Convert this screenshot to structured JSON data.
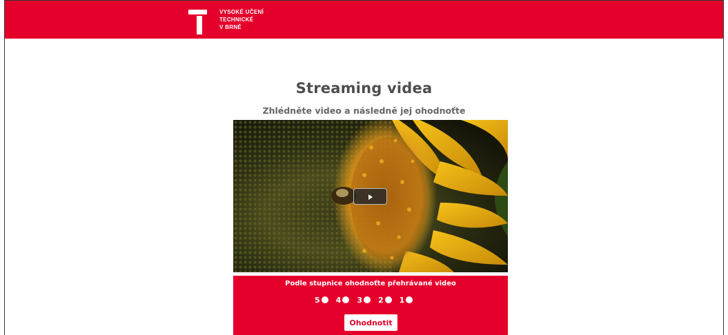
{
  "header": {
    "logo_lines": [
      "VYSOKÉ UČENÍ",
      "TECHNICKÉ",
      "V BRNĚ"
    ]
  },
  "main": {
    "title": "Streaming videa",
    "subtitle": "Zhlédněte video a následně jej ohodnoťte"
  },
  "video": {
    "thumbnail": "sunflower-with-bee"
  },
  "rating": {
    "prompt": "Podle stupnice ohodnoťte přehrávané video",
    "options": [
      "5",
      "4",
      "3",
      "2",
      "1"
    ],
    "submit_label": "Ohodnotit"
  },
  "colors": {
    "brand_red": "#e4002b",
    "title_text": "#4d4d4d"
  }
}
